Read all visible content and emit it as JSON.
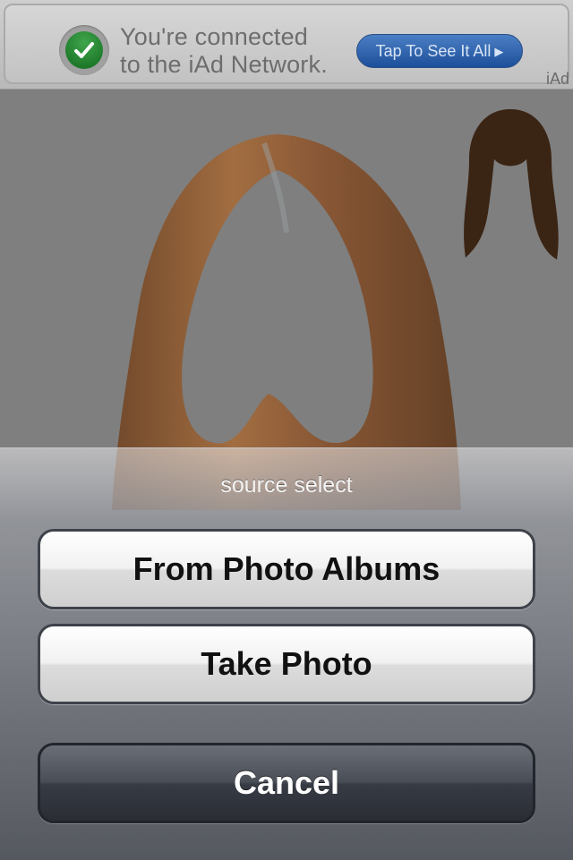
{
  "ad": {
    "line1": "You're connected",
    "line2": "to the iAd Network.",
    "cta_label": "Tap To See It All",
    "cta_arrow": "▶",
    "logo": "iAd",
    "check_icon": "checkmark-icon"
  },
  "canvas": {
    "main_image": "hair-wig-icon",
    "thumb_image": "hair-style-thumbnail"
  },
  "action_sheet": {
    "title": "source select",
    "buttons": [
      {
        "label": "From Photo Albums"
      },
      {
        "label": "Take Photo"
      }
    ],
    "cancel_label": "Cancel"
  },
  "colors": {
    "ad_cta": "#1d4f9a",
    "check_green": "#2a8c36",
    "hair": "#9a5a2a"
  }
}
